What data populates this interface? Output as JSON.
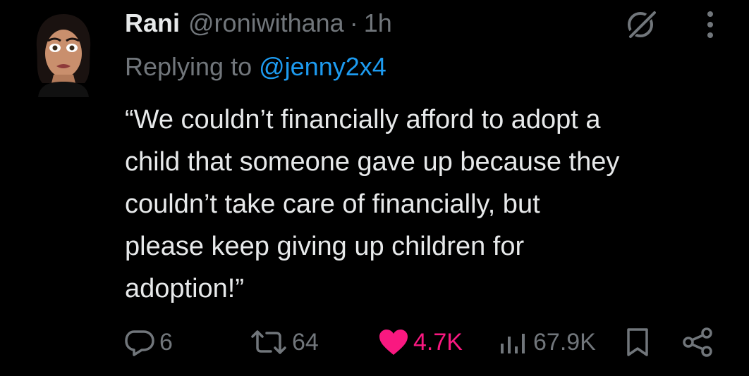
{
  "tweet": {
    "author_name": "Rani",
    "author_handle": "@roniwithana",
    "separator": "·",
    "time": "1h",
    "reply_prefix": "Replying to",
    "reply_to": "@jenny2x4",
    "text": "“We couldn’t financially afford to adopt a\nchild that someone gave up because they\ncouldn’t take care of financially, but\nplease keep giving up children for\nadoption!”"
  },
  "actions": {
    "replies": "6",
    "reposts": "64",
    "likes": "4.7K",
    "views": "67.9K"
  },
  "icons": {
    "header": [
      "grok-icon",
      "more-icon"
    ],
    "actions": [
      "reply-icon",
      "repost-icon",
      "like-icon",
      "views-icon",
      "bookmark-icon",
      "share-icon"
    ]
  },
  "colors": {
    "background": "#000000",
    "text": "#e7e9ea",
    "muted": "#71767b",
    "link": "#1d9bf0",
    "like": "#f91880"
  }
}
